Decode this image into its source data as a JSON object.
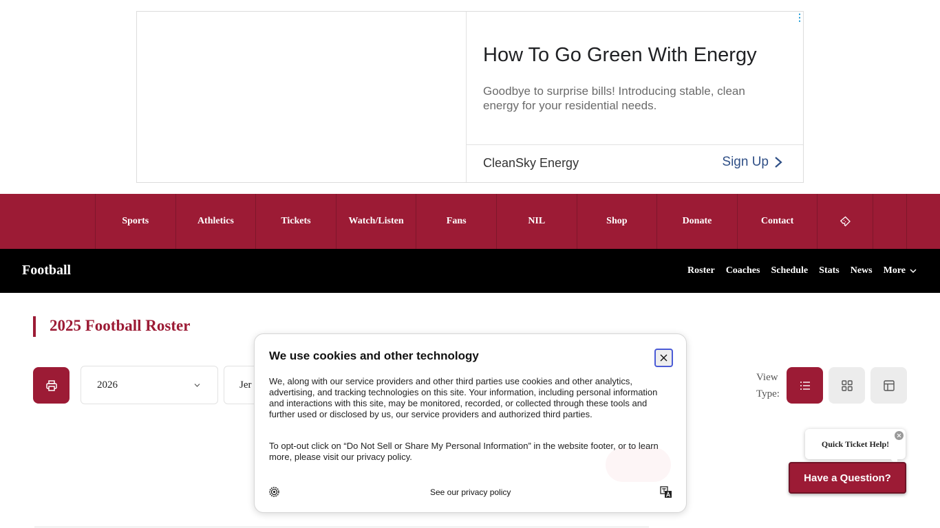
{
  "ad": {
    "title": "How To Go Green With Energy",
    "body": "Goodbye to surprise bills! Introducing stable, clean energy for your residential needs.",
    "advertiser": "CleanSky Energy",
    "cta": "Sign Up",
    "options_icon": "⋮"
  },
  "main_nav": {
    "items": [
      {
        "label": "Sports"
      },
      {
        "label": "Athletics"
      },
      {
        "label": "Tickets"
      },
      {
        "label": "Watch/Listen"
      },
      {
        "label": "Fans"
      },
      {
        "label": "NIL"
      },
      {
        "label": "Shop"
      },
      {
        "label": "Donate"
      },
      {
        "label": "Contact"
      }
    ],
    "ticket_icon": "ticket-icon"
  },
  "sub_nav": {
    "title": "Football",
    "links": [
      "Roster",
      "Coaches",
      "Schedule",
      "Stats",
      "News"
    ],
    "more": "More"
  },
  "roster": {
    "title": "2025 Football Roster",
    "season_value": "2026",
    "sort_value": "Jer",
    "view_type_label": "View Type:"
  },
  "cookie": {
    "title": "We use cookies and other technology",
    "text1": "We, along with our service providers and other third parties use cookies and other analytics, advertising, and tracking technologies on this site. Your information, including personal information and interactions with this site, may be monitored, recorded, or collected through these tools and further used or disclosed by us, our service providers and authorized third parties.",
    "text2": "To opt-out click on “Do Not Sell or Share My Personal Information” in the website footer, or to learn more, please visit our privacy policy.",
    "privacy_link": "See our privacy policy"
  },
  "chat": {
    "bubble": "Quick Ticket Help!",
    "button": "Have a Question?"
  },
  "colors": {
    "brand": "#9c1b35",
    "subnav_bg": "#000000",
    "focus_ring": "#4a5ad6"
  }
}
